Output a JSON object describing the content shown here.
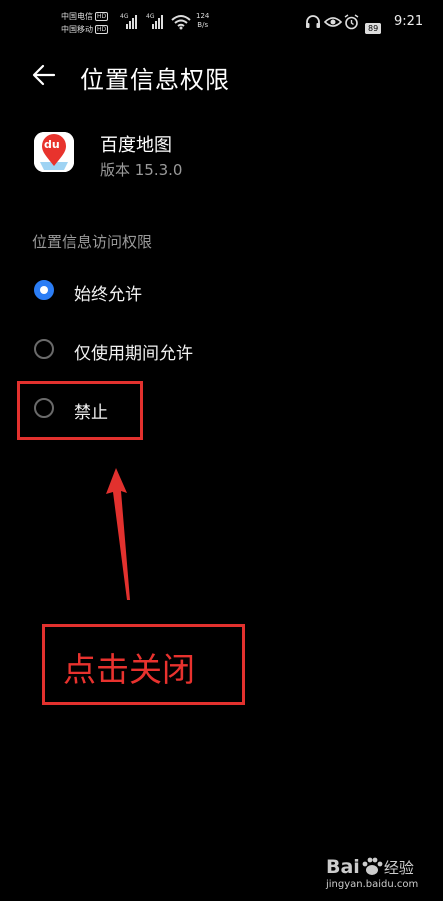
{
  "status_bar": {
    "carrier1": "中国电信",
    "carrier2": "中国移动",
    "hd": "HD",
    "net_4g_1": "4G",
    "net_4g_2": "4G",
    "speed_value": "124",
    "speed_unit": "B/s",
    "battery": "89",
    "time": "9:21"
  },
  "header": {
    "title": "位置信息权限"
  },
  "app": {
    "name": "百度地图",
    "version": "版本 15.3.0",
    "icon_text": "du"
  },
  "section_title": "位置信息访问权限",
  "options": [
    {
      "label": "始终允许",
      "selected": true
    },
    {
      "label": "仅使用期间允许",
      "selected": false
    },
    {
      "label": "禁止",
      "selected": false
    }
  ],
  "annotation": {
    "text": "点击关闭",
    "color": "#e2312e"
  },
  "watermark": {
    "brand": "Bai",
    "brand2": "经验",
    "url": "jingyan.baidu.com"
  },
  "colors": {
    "accent": "#2b7df5",
    "background": "#000000"
  }
}
